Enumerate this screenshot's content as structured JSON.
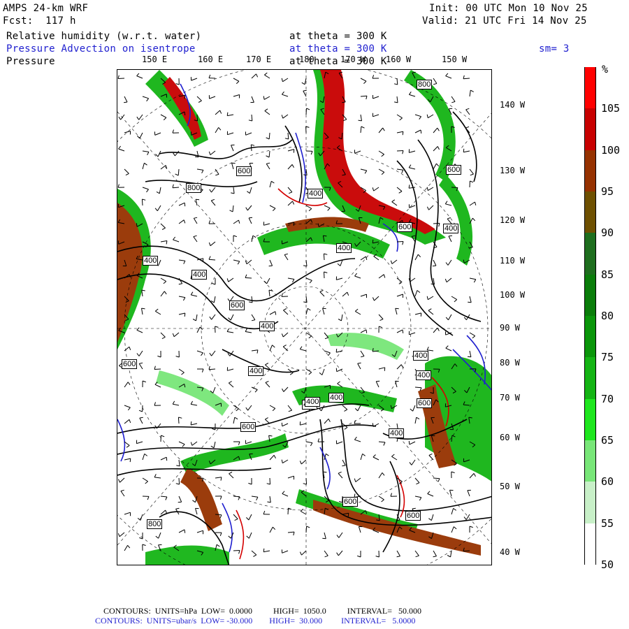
{
  "header": {
    "left_line1": "AMPS 24-km WRF",
    "left_line2": "Fcst:  117 h",
    "right_line1": "Init: 00 UTC Mon 10 Nov 25",
    "right_line2": "Valid: 21 UTC Fri 14 Nov 25",
    "field1_name": "Relative humidity (w.r.t. water)",
    "field1_level": "at theta = 300 K",
    "field2_name": "Pressure Advection on isentrope",
    "field2_level": "at theta = 300 K",
    "field2_smooth": "sm= 3",
    "field3_name": "Pressure",
    "field3_level": "at theta = 300 K"
  },
  "map": {
    "lon_labels_top": [
      "150 E",
      "160 E",
      "170 E",
      "180",
      "170 W",
      "160 W",
      "150 W"
    ],
    "lat_labels_right": [
      "140 W",
      "130 W",
      "120 W",
      "110 W",
      "100 W",
      "90 W",
      "80 W",
      "70 W",
      "60 W",
      "50 W",
      "40 W"
    ],
    "pressure_labels": [
      "800",
      "600",
      "600",
      "800",
      "600",
      "400",
      "400",
      "400",
      "400",
      "600",
      "400",
      "400",
      "400",
      "400",
      "400",
      "400",
      "600",
      "800",
      "600",
      "600",
      "400",
      "600",
      "400",
      "600",
      "400"
    ],
    "colors": {
      "contour_black": "#000000",
      "advection_blue": "#1f1fcf",
      "advection_red": "#d40000"
    }
  },
  "colorbar": {
    "unit": "%",
    "labels": [
      "105",
      "100",
      "95",
      "90",
      "85",
      "80",
      "75",
      "70",
      "65",
      "60",
      "55",
      "50"
    ],
    "colors": [
      "#ff0000",
      "#c80000",
      "#963200",
      "#6e5000",
      "#1e6e1e",
      "#0a7d0a",
      "#0a960a",
      "#14b414",
      "#1ee61e",
      "#78e678",
      "#c8f0c8",
      "#ffffff"
    ]
  },
  "footer": {
    "line1": "CONTOURS:  UNITS=hPa  LOW=  0.0000          HIGH=  1050.0          INTERVAL=   50.000",
    "line2": "CONTOURS:  UNITS=ubar/s  LOW= -30.000        HIGH=  30.000         INTERVAL=   5.0000"
  }
}
